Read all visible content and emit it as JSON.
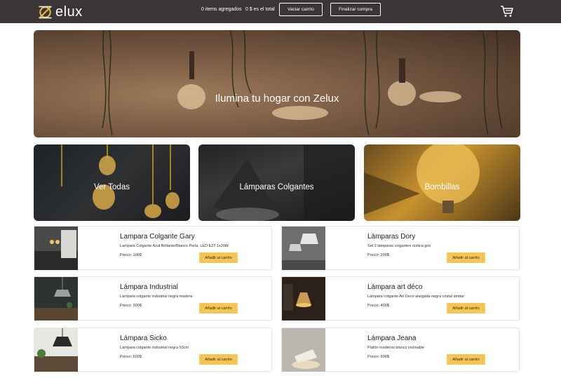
{
  "header": {
    "brand": "elux",
    "items_count": "0 items agregados",
    "total": "0 $ es el total",
    "empty_cart_label": "Vaciar carrito",
    "checkout_label": "Finalizar compra"
  },
  "hero": {
    "title": "Ilumina tu hogar con Zelux"
  },
  "categories": [
    {
      "label": "Ver Todas"
    },
    {
      "label": "Lámparas Colgantes"
    },
    {
      "label": "Bombillas"
    }
  ],
  "products": [
    {
      "name": "Lampara Colgante Gary",
      "description": "Lampara Colgante Azul Brillante/Blanco Perla, LED E27 1x20W",
      "price": "Precio: 100$",
      "button": "Añadir al carrito"
    },
    {
      "name": "Lámparas Dory",
      "description": "Set 2 lámparas colgantes rústica gris",
      "price": "Precio: 200$",
      "button": "Añadir al carrito"
    },
    {
      "name": "Lámpara Industrial",
      "description": "Lámpara colgante industrial negra madera",
      "price": "Precio: 300$",
      "button": "Añadir al carrito"
    },
    {
      "name": "Lámpara art déco",
      "description": "Lámpara colgante Art Deco alargada negra cristal ámbar",
      "price": "Precio: 400$",
      "button": "Añadir al carrito"
    },
    {
      "name": "Lámpara Sicko",
      "description": "Lámpara colgante industrial negra 53cm",
      "price": "Precio: 500$",
      "button": "Añadir al carrito"
    },
    {
      "name": "Lámpara Jeana",
      "description": "Plafón moderno blanco inclinable",
      "price": "Precio: 600$",
      "button": "Añadir al carrito"
    }
  ],
  "colors": {
    "topbar": "#3b3535",
    "accent": "#f3c555",
    "logo_gold": "#e9b949"
  }
}
